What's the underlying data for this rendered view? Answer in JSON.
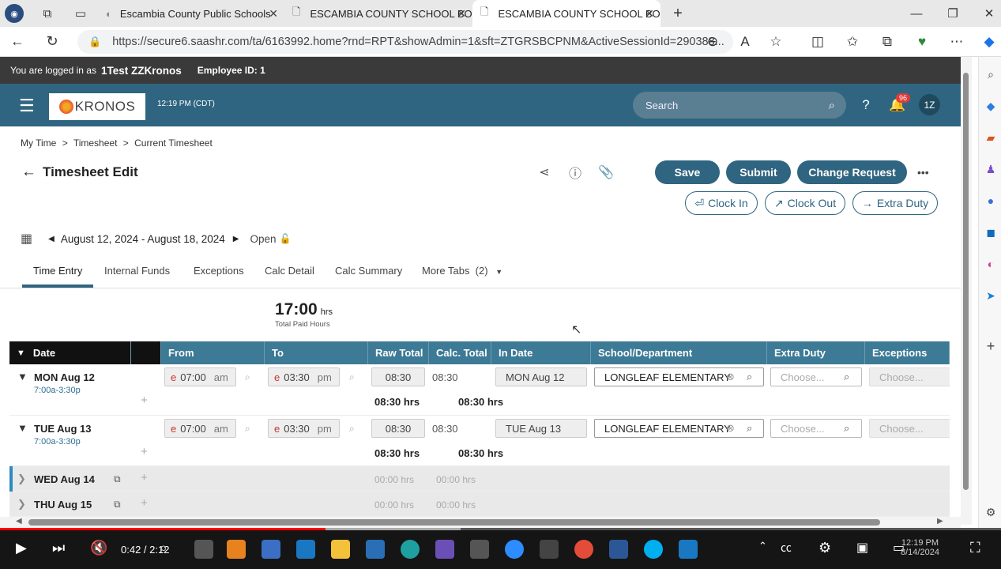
{
  "browser": {
    "tabs": [
      {
        "label": "Escambia County Public Schools",
        "active": false
      },
      {
        "label": "ESCAMBIA COUNTY SCHOOL BO",
        "active": false
      },
      {
        "label": "ESCAMBIA COUNTY SCHOOL BO",
        "active": true
      }
    ],
    "new_tab": "+",
    "url": "https://secure6.saashr.com/ta/6163992.home?rnd=RPT&showAdmin=1&sft=ZTGRSBCPNM&ActiveSessionId=290388...",
    "toolbar_icons": [
      "zoom-icon",
      "read-aloud-icon",
      "favorite-star-icon",
      "split-screen-icon",
      "favorites-icon",
      "collections-icon",
      "extensions-icon",
      "more-icon",
      "copilot-icon"
    ]
  },
  "login": {
    "prefix": "You are logged in as",
    "user": "1Test ZZKronos",
    "employee": "Employee ID: 1"
  },
  "header": {
    "logo": "KRONOS",
    "time": "12:19 PM (CDT)",
    "search_placeholder": "Search",
    "notif_count": "96",
    "avatar": "1Z",
    "brand_color": "#2f6580"
  },
  "breadcrumb": {
    "a": "My Time",
    "b": "Timesheet",
    "c": "Current Timesheet",
    "sep": ">"
  },
  "page": {
    "title": "Timesheet Edit"
  },
  "actions": {
    "save": "Save",
    "submit": "Submit",
    "change_request": "Change Request",
    "more": "•••"
  },
  "punch": {
    "clock_in": "Clock In",
    "clock_out": "Clock Out",
    "extra_duty": "Extra Duty"
  },
  "period": {
    "range": "August 12, 2024 - August 18, 2024",
    "status": "Open"
  },
  "tabs": [
    "Time Entry",
    "Internal Funds",
    "Exceptions",
    "Calc Detail",
    "Calc Summary",
    "More Tabs  (2)"
  ],
  "totals": {
    "hours": "17:00",
    "unit": "hrs",
    "label": "Total Paid Hours"
  },
  "grid": {
    "headers": [
      "Date",
      "From",
      "To",
      "Raw Total",
      "Calc. Total",
      "In Date",
      "School/Department",
      "Extra Duty",
      "Exceptions"
    ],
    "rows": [
      {
        "day": "MON Aug 12",
        "sched": "7:00a-3:30p",
        "from": "07:00",
        "from_ampm": "am",
        "to": "03:30",
        "to_ampm": "pm",
        "raw": "08:30",
        "calc": "08:30",
        "in_date": "MON Aug 12",
        "dept": "LONGLEAF ELEMENTARY",
        "extra": "Choose...",
        "exc": "Choose...",
        "raw_sum": "08:30 hrs",
        "calc_sum": "08:30 hrs"
      },
      {
        "day": "TUE Aug 13",
        "sched": "7:00a-3:30p",
        "from": "07:00",
        "from_ampm": "am",
        "to": "03:30",
        "to_ampm": "pm",
        "raw": "08:30",
        "calc": "08:30",
        "in_date": "TUE Aug 13",
        "dept": "LONGLEAF ELEMENTARY",
        "extra": "Choose...",
        "exc": "Choose...",
        "raw_sum": "08:30 hrs",
        "calc_sum": "08:30 hrs"
      },
      {
        "day": "WED Aug 14",
        "raw_sum": "00:00 hrs",
        "calc_sum": "00:00 hrs"
      },
      {
        "day": "THU Aug 15",
        "raw_sum": "00:00 hrs",
        "calc_sum": "00:00 hrs"
      }
    ]
  },
  "video": {
    "time": "0:42 / 2:12",
    "progress": 0.325,
    "buffered": 0.46
  },
  "taskbar": {
    "clock_time": "12:19 PM",
    "clock_date": "8/14/2024"
  }
}
